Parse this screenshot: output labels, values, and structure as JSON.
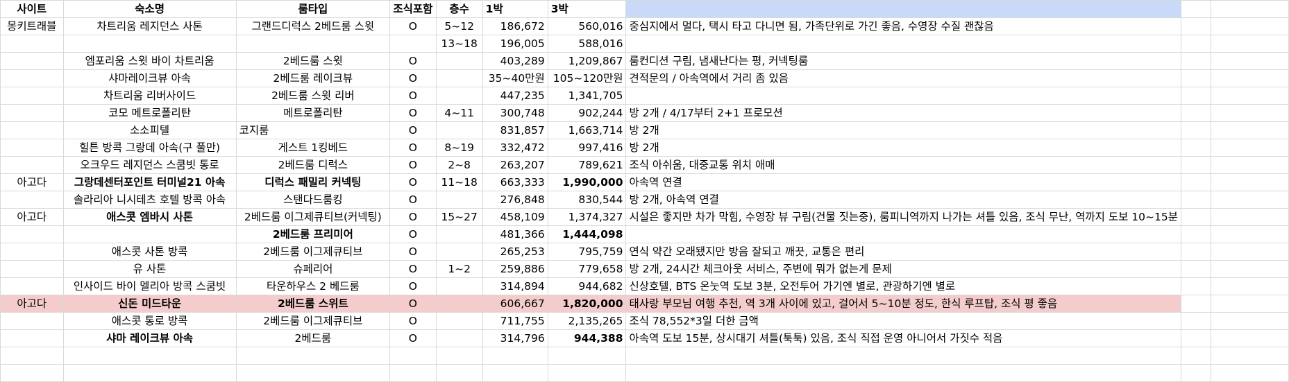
{
  "sheet": {
    "headers": [
      "사이트",
      "숙소명",
      "룸타입",
      "조식포함",
      "층수",
      "1박",
      "3박",
      "",
      "",
      ""
    ],
    "rows": [
      {
        "site": "몽키트래블",
        "name": "차트리움 레지던스 사톤",
        "room": "그랜드디럭스 2베드룸 스윗",
        "bf": "O",
        "floor": "5~12",
        "n1": "186,672",
        "n3": "560,016",
        "note": "중심지에서 멀다, 택시 타고 다니면 됨, 가족단위로 가긴 좋음, 수영장 수질 괜찮음"
      },
      {
        "site": "",
        "name": "",
        "room": "",
        "bf": "",
        "floor": "13~18",
        "n1": "196,005",
        "n3": "588,016",
        "note": ""
      },
      {
        "site": "",
        "name": "엠포리움 스윗 바이 차트리움",
        "room": "2베드룸 스윗",
        "bf": "O",
        "floor": "",
        "n1": "403,289",
        "n3": "1,209,867",
        "note": "룸컨디션 구림, 냄새난다는 평, 커넥팅룸"
      },
      {
        "site": "",
        "name": "샤마레이크뷰 아속",
        "room": "2베드룸 레이크뷰",
        "bf": "O",
        "floor": "",
        "n1": "35~40만원",
        "n3": "105~120만원",
        "note": "견적문의 / 아속역에서 거리 좀 있음"
      },
      {
        "site": "",
        "name": "차트리움 리버사이드",
        "room": "2베드룸 스윗 리버",
        "bf": "O",
        "floor": "",
        "n1": "447,235",
        "n3": "1,341,705",
        "note": ""
      },
      {
        "site": "",
        "name": "코모 메트로폴리탄",
        "room": "메트로폴리탄",
        "bf": "O",
        "floor": "4~11",
        "n1": "300,748",
        "n3": "902,244",
        "note": "방 2개 / 4/17부터 2+1 프로모션"
      },
      {
        "site": "",
        "name": "소소피텔",
        "room": "코지룸",
        "bf": "O",
        "floor": "",
        "n1": "831,857",
        "n3": "1,663,714",
        "note": "방 2개"
      },
      {
        "site": "",
        "name": "힐튼 방콕 그랑데 아속(구 풀만)",
        "room": "게스트 1킹베드",
        "bf": "O",
        "floor": "8~19",
        "n1": "332,472",
        "n3": "997,416",
        "note": "방 2개"
      },
      {
        "site": "",
        "name": "오크우드 레지던스 스쿰빗 통로",
        "room": "2베드룸 디럭스",
        "bf": "O",
        "floor": "2~8",
        "n1": "263,207",
        "n3": "789,621",
        "note": "조식 아쉬움, 대중교통 위치 애매"
      },
      {
        "site": "아고다",
        "name": "그랑데센터포인트 터미널21 아속",
        "room": "디럭스 패밀리 커넥팅",
        "bf": "O",
        "floor": "11~18",
        "n1": "663,333",
        "n3": "1,990,000",
        "note": "아속역 연결"
      },
      {
        "site": "",
        "name": "솔라리아 니시테츠 호텔 방콕 아속",
        "room": "스탠다드룸킹",
        "bf": "O",
        "floor": "",
        "n1": "276,848",
        "n3": "830,544",
        "note": "방 2개, 아속역 연결"
      },
      {
        "site": "아고다",
        "name": "애스콧 엠바시 사톤",
        "room": "2베드룸 이그제큐티브(커넥팅)",
        "bf": "O",
        "floor": "15~27",
        "n1": "458,109",
        "n3": "1,374,327",
        "note": "시설은 좋지만 차가 막힘, 수영장 뷰 구림(건물 짓는중), 룸피니역까지 나가는 셔틀 있음, 조식 무난, 역까지 도보 10~15분"
      },
      {
        "site": "",
        "name": "",
        "room": "2베드룸 프리미어",
        "bf": "O",
        "floor": "",
        "n1": "481,366",
        "n3": "1,444,098",
        "note": ""
      },
      {
        "site": "",
        "name": "애스콧 사톤 방콕",
        "room": "2베드룸 이그제큐티브",
        "bf": "O",
        "floor": "",
        "n1": "265,253",
        "n3": "795,759",
        "note": "연식 약간 오래됐지만 방음 잘되고 깨끗, 교통은 편리"
      },
      {
        "site": "",
        "name": "유 사톤",
        "room": "슈페리어",
        "bf": "O",
        "floor": "1~2",
        "n1": "259,886",
        "n3": "779,658",
        "note": "방 2개, 24시간 체크아웃 서비스, 주변에 뭐가 없는게 문제"
      },
      {
        "site": "",
        "name": "인사이드 바이 멜리아 방콕 스쿰빗",
        "room": "타운하우스 2 베드룸",
        "bf": "O",
        "floor": "",
        "n1": "314,894",
        "n3": "944,682",
        "note": "신상호텔, BTS 온눗역 도보 3분, 오전투어 가기엔 별로, 관광하기엔 별로"
      },
      {
        "site": "아고다",
        "name": "신돈 미드타운",
        "room": "2베드룸 스위트",
        "bf": "O",
        "floor": "",
        "n1": "606,667",
        "n3": "1,820,000",
        "note": "태사랑 부모님 여행 추천, 역 3개 사이에 있고, 걸어서 5~10분 정도, 한식 루프탑, 조식 평 좋음"
      },
      {
        "site": "",
        "name": "애스콧 통로 방콕",
        "room": "2베드룸 이그제큐티브",
        "bf": "O",
        "floor": "",
        "n1": "711,755",
        "n3": "2,135,265",
        "note": "조식 78,552*3일 더한 금액"
      },
      {
        "site": "",
        "name": "샤마 레이크뷰 아속",
        "room": "2베드룸",
        "bf": "O",
        "floor": "",
        "n1": "314,796",
        "n3": "944,388",
        "note": "아속역 도보 15분, 상시대기 셔틀(툭툭) 있음, 조식 직접 운영 아니어서 가짓수 적음"
      }
    ]
  }
}
